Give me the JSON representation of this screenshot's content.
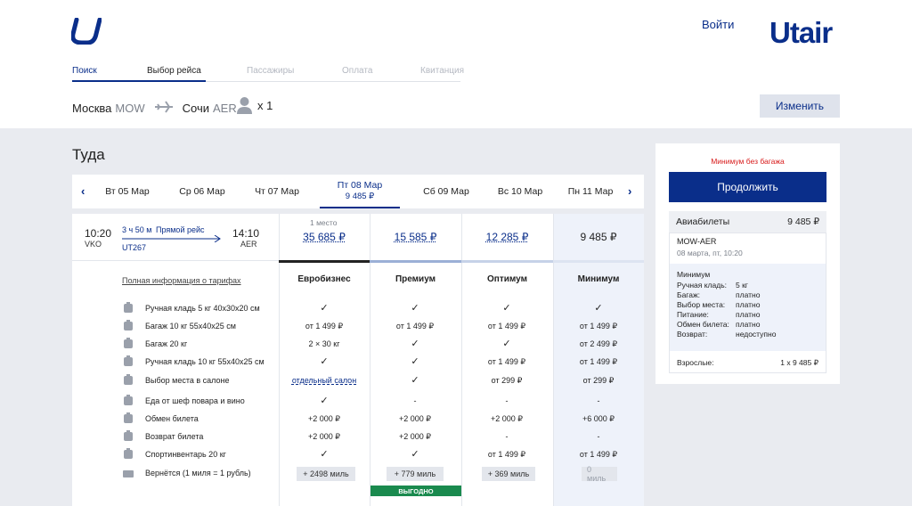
{
  "header": {
    "login_label": "Войти",
    "brand": "Utair",
    "steps": [
      {
        "label": "Поиск"
      },
      {
        "label": "Выбор рейса"
      },
      {
        "label": "Пассажиры"
      },
      {
        "label": "Оплата"
      },
      {
        "label": "Квитанция"
      }
    ],
    "route": {
      "from_city": "Москва",
      "from_code": "MOW",
      "to_city": "Сочи",
      "to_code": "AER"
    },
    "passengers": "x 1",
    "change_label": "Изменить"
  },
  "main": {
    "title": "Туда",
    "dates": [
      {
        "label": "Вт 05 Мар",
        "price": ""
      },
      {
        "label": "Ср 06 Мар",
        "price": ""
      },
      {
        "label": "Чт 07 Мар",
        "price": ""
      },
      {
        "label": "Пт 08 Мар",
        "price": "9 485 ₽"
      },
      {
        "label": "Сб 09 Мар",
        "price": ""
      },
      {
        "label": "Вс 10 Мар",
        "price": ""
      },
      {
        "label": "Пн 11 Мар",
        "price": ""
      }
    ],
    "flight": {
      "dep_time": "10:20",
      "dep_code": "VKO",
      "arr_time": "14:10",
      "arr_code": "AER",
      "duration": "3 ч 50 м",
      "direct": "Прямой рейс",
      "number": "UT267"
    },
    "seats_note": "1 место",
    "prices": [
      "35 685 ₽",
      "15 585 ₽",
      "12 285 ₽",
      "9 485 ₽"
    ],
    "full_info": "Полная информация о тарифах",
    "tiers": [
      "Евробизнес",
      "Премиум",
      "Оптимум",
      "Минимум"
    ],
    "features": [
      {
        "label": "Ручная кладь 5 кг 40x30x20 см",
        "icon": "hand-luggage-icon",
        "values": [
          "✓",
          "✓",
          "✓",
          "✓"
        ]
      },
      {
        "label": "Багаж 10 кг 55x40x25 см",
        "icon": "baggage-10-icon",
        "values": [
          "от 1 499 ₽",
          "от 1 499 ₽",
          "от 1 499 ₽",
          "от 1 499 ₽"
        ]
      },
      {
        "label": "Багаж 20 кг",
        "icon": "baggage-20-icon",
        "values": [
          "2 × 30 кг",
          "✓",
          "✓",
          "от 2 499 ₽"
        ]
      },
      {
        "label": "Ручная кладь 10 кг 55x40x25 см",
        "icon": "hand-luggage-10-icon",
        "values": [
          "✓",
          "✓",
          "от 1 499 ₽",
          "от 1 499 ₽"
        ]
      },
      {
        "label": "Выбор места в салоне",
        "icon": "seat-icon",
        "values": [
          "отдельный салон",
          "✓",
          "от 299 ₽",
          "от 299 ₽"
        ]
      },
      {
        "label": "Еда от шеф повара и вино",
        "icon": "meal-icon",
        "values": [
          "✓",
          "-",
          "-",
          "-"
        ]
      },
      {
        "label": "Обмен билета",
        "icon": "exchange-icon",
        "values": [
          "+2 000 ₽",
          "+2 000 ₽",
          "+2 000 ₽",
          "+6 000 ₽"
        ]
      },
      {
        "label": "Возврат билета",
        "icon": "refund-icon",
        "values": [
          "+2 000 ₽",
          "+2 000 ₽",
          "-",
          "-"
        ]
      },
      {
        "label": "Спортинвентарь 20 кг",
        "icon": "sport-icon",
        "values": [
          "✓",
          "✓",
          "от 1 499 ₽",
          "от 1 499 ₽"
        ]
      }
    ],
    "miles_label": "Вернётся (1 миля = 1 рубль)",
    "miles_icon": "miles-icon",
    "miles": [
      "+ 2498 миль",
      "+ 779 миль",
      "+ 369 миль",
      "0 миль"
    ],
    "badge": "ВЫГОДНО"
  },
  "summary": {
    "warning": "Минимум без багажа",
    "continue_label": "Продолжить",
    "tickets_label": "Авиабилеты",
    "tickets_total": "9 485 ₽",
    "route": "MOW-AER",
    "date": "08 марта, пт, 10:20",
    "fare_name": "Минимум",
    "fare_rows": [
      {
        "k": "Ручная кладь:",
        "v": "5 кг"
      },
      {
        "k": "Багаж:",
        "v": "платно"
      },
      {
        "k": "Выбор места:",
        "v": "платно"
      },
      {
        "k": "Питание:",
        "v": "платно"
      },
      {
        "k": "Обмен билета:",
        "v": "платно"
      },
      {
        "k": "Возврат:",
        "v": "недоступно"
      }
    ],
    "adults_label": "Взрослые:",
    "adults_value": "1 x 9 485 ₽"
  },
  "colors": {
    "brand": "#0a2e8a",
    "warning": "#d81b1b",
    "badge": "#1a8a4e"
  }
}
